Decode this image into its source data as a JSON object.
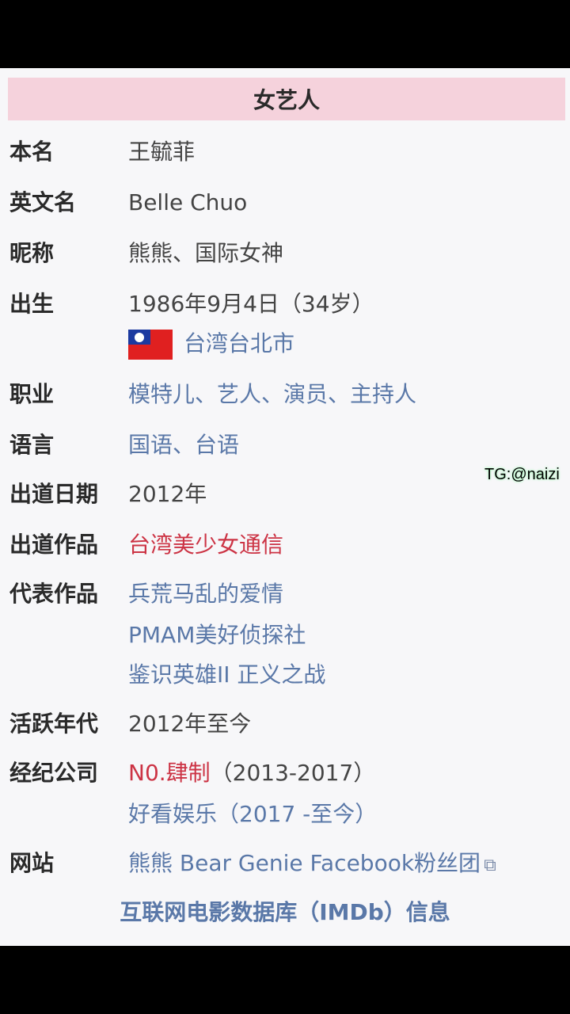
{
  "header": {
    "title": "女艺人"
  },
  "rows": {
    "name": {
      "label": "本名",
      "value": "王毓菲"
    },
    "english_name": {
      "label": "英文名",
      "value": "Belle Chuo"
    },
    "nickname": {
      "label": "昵称",
      "value": "熊熊、国际女神"
    },
    "birth": {
      "label": "出生",
      "date": "1986年9月4日（34岁）",
      "place": "台湾台北市",
      "flag_icon": "taiwan-flag-icon"
    },
    "occupation": {
      "label": "职业",
      "value": "模特儿、艺人、演员、主持人"
    },
    "language": {
      "label": "语言",
      "value": "国语、台语"
    },
    "debut_date": {
      "label": "出道日期",
      "value": "2012年"
    },
    "debut_work": {
      "label": "出道作品",
      "value": "台湾美少女通信"
    },
    "notable_works": {
      "label": "代表作品",
      "items": [
        "兵荒马乱的爱情",
        "PMAM美好侦探社",
        "鉴识英雄II 正义之战"
      ]
    },
    "active_years": {
      "label": "活跃年代",
      "value": "2012年至今"
    },
    "agency": {
      "label": "经纪公司",
      "first_name": "N0.肆制",
      "first_years": "（2013-2017）",
      "second": "好看娱乐（2017 -至今）"
    },
    "website": {
      "label": "网站",
      "value": "熊熊 Bear Genie Facebook粉丝团"
    }
  },
  "imdb_link": "互联网电影数据库（IMDb）信息",
  "watermark": "TG:@naizi",
  "colors": {
    "header_bg": "#f5d2dc",
    "link": "#5a78a8",
    "red_link": "#cc3344"
  }
}
